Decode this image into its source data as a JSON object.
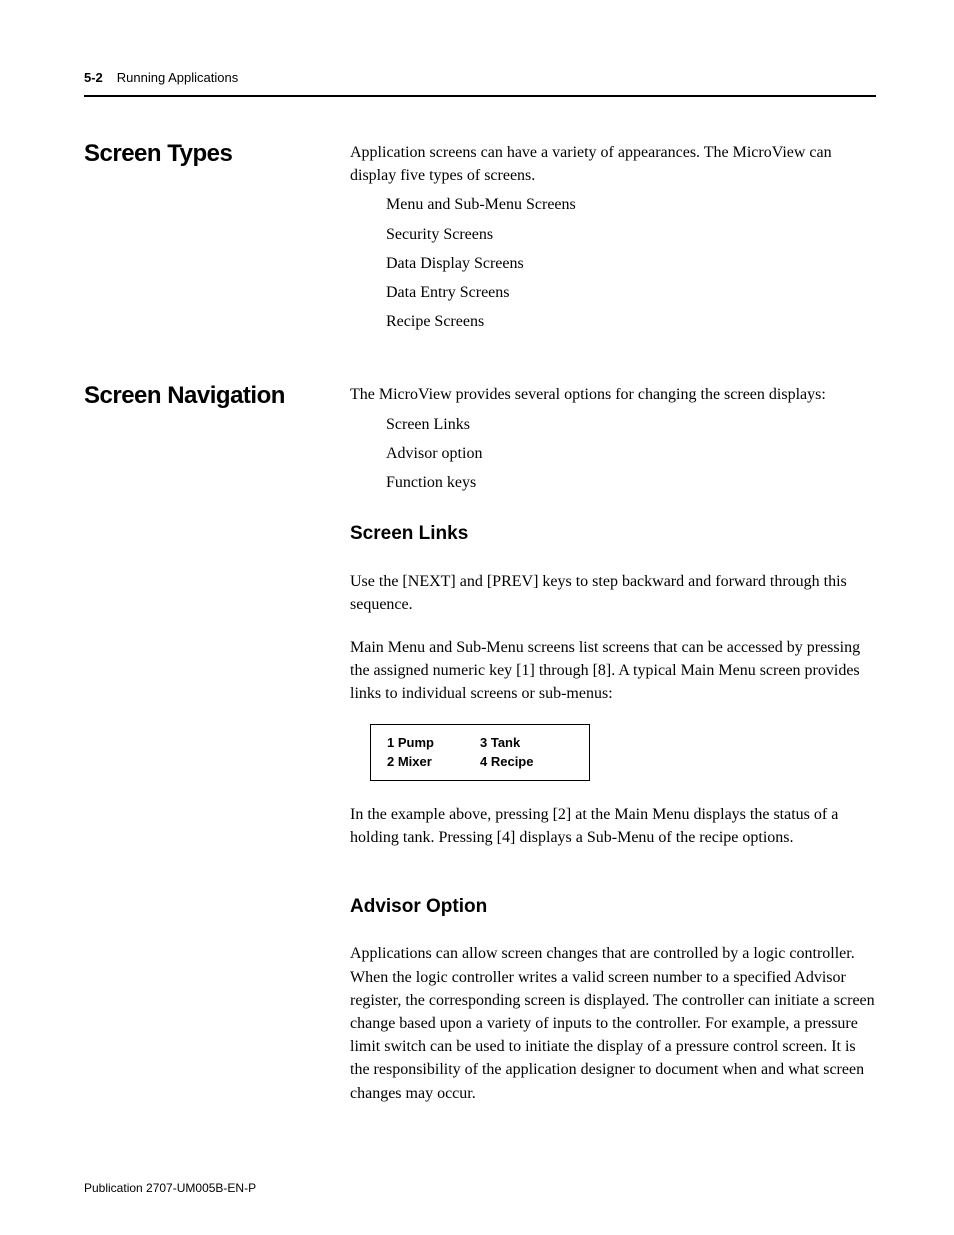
{
  "header": {
    "page_number": "5-2",
    "chapter_title": "Running Applications"
  },
  "sections": [
    {
      "title": "Screen Types",
      "intro": "Application screens can have a variety of appearances. The MicroView can display five types of screens.",
      "items": [
        "Menu and Sub-Menu Screens",
        "Security Screens",
        "Data Display Screens",
        "Data Entry Screens",
        "Recipe Screens"
      ]
    },
    {
      "title": "Screen Navigation",
      "intro": "The MicroView provides several options for changing the screen displays:",
      "items": [
        "Screen Links",
        "Advisor option",
        "Function keys"
      ]
    }
  ],
  "screen_links": {
    "heading": "Screen Links",
    "p1": "Use the [NEXT] and [PREV] keys to step backward and forward through this sequence.",
    "p2": "Main Menu and Sub-Menu screens list screens that can be accessed by pressing the assigned numeric key [1] through [8]. A typical Main Menu screen provides links to individual screens or sub-menus:",
    "menu": {
      "c0r0": "1  Pump",
      "c0r1": "2  Mixer",
      "c1r0": "3  Tank",
      "c1r1": "4  Recipe"
    },
    "p3": "In the example above, pressing [2] at the Main Menu displays the status of a holding tank. Pressing [4] displays a Sub-Menu of the recipe options."
  },
  "advisor": {
    "heading": "Advisor Option",
    "p1": "Applications can allow screen changes that are controlled by a logic controller. When the logic controller writes a valid screen number to a specified Advisor register, the corresponding screen is displayed. The controller can initiate a screen change based upon a variety of inputs to the controller. For example, a pressure limit switch can be used to initiate the display of a pressure control screen. It is the responsibility of the application designer to document when and what screen changes may occur."
  },
  "footer": {
    "publication": "Publication 2707-UM005B-EN-P"
  }
}
